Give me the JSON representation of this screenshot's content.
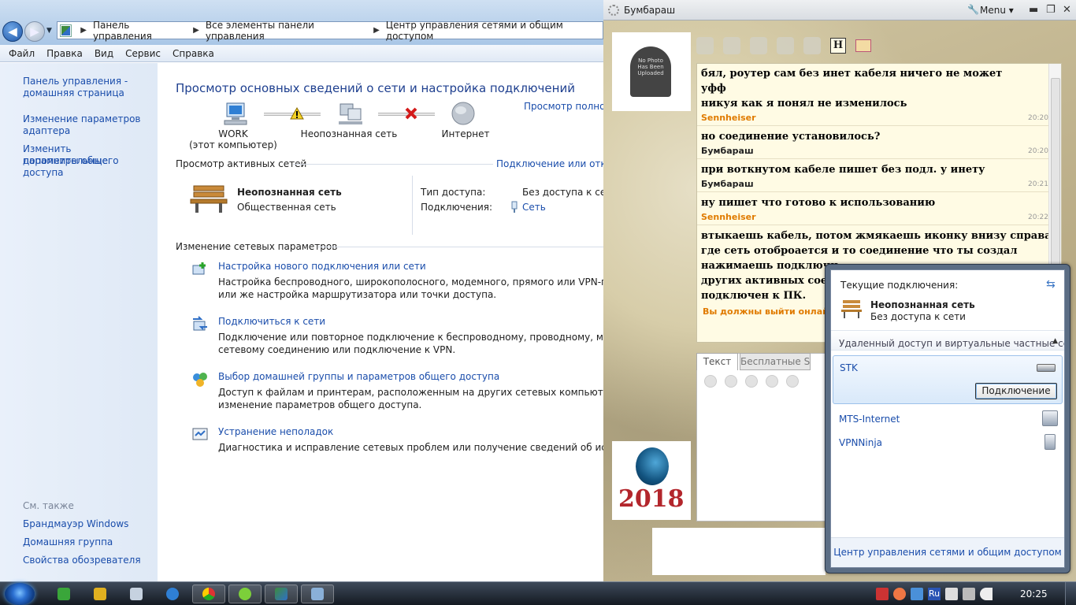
{
  "explorer": {
    "breadcrumb": [
      "Панель управления",
      "Все элементы панели управления",
      "Центр управления сетями и общим доступом"
    ],
    "menu": [
      "Файл",
      "Правка",
      "Вид",
      "Сервис",
      "Справка"
    ],
    "sidebar": {
      "links": [
        "Панель управления -",
        "домашняя страница",
        "Изменение параметров",
        "адаптера",
        "Изменить дополнительные",
        "параметры общего доступа"
      ],
      "see_also_title": "См. также",
      "see_also": [
        "Брандмауэр Windows",
        "Домашняя группа",
        "Свойства обозревателя"
      ]
    },
    "main": {
      "title": "Просмотр основных сведений о сети и настройка подключений",
      "full_map": "Просмотр полной",
      "map": {
        "computer_name": "WORK",
        "computer_sub": "(этот компьютер)",
        "network": "Неопознанная сеть",
        "internet": "Интернет"
      },
      "active_header": "Просмотр активных сетей",
      "connect_disconnect": "Подключение или откл",
      "active": {
        "name": "Неопознанная сеть",
        "type": "Общественная сеть",
        "access_label": "Тип доступа:",
        "access_value": "Без доступа к сети",
        "conn_label": "Подключения:",
        "conn_value": "Сеть"
      },
      "change_header": "Изменение сетевых параметров",
      "tasks": [
        {
          "title": "Настройка нового подключения или сети",
          "line1": "Настройка беспроводного, широкополосного, модемного, прямого или VPN-подклю",
          "line2": "или же настройка маршрутизатора или точки доступа."
        },
        {
          "title": "Подключиться к сети",
          "line1": "Подключение или повторное подключение к беспроводному, проводному, модемному",
          "line2": "сетевому соединению или подключение к VPN."
        },
        {
          "title": "Выбор домашней группы и параметров общего доступа",
          "line1": "Доступ к файлам и принтерам, расположенным на других сетевых компьютерах, или",
          "line2": "изменение параметров общего доступа."
        },
        {
          "title": "Устранение неполадок",
          "line1": "Диагностика и исправление сетевых проблем или получение сведений об исправлени",
          "line2": ""
        }
      ]
    }
  },
  "chat": {
    "title": "Бумбараш",
    "menu_label": "Menu ▾",
    "avatar_text": "No Photo Has Been Uploaded",
    "logo_text": "2018",
    "h_label": "H",
    "messages": [
      {
        "text": "бял, роутер сам без инет кабеля ничего не может"
      },
      {
        "text": "уфф"
      },
      {
        "text": "никуя как я понял не изменилось",
        "nick": "Sennheiser",
        "time": "20:20"
      },
      {
        "text": "но соединение установилось?",
        "nick": "Бумбараш",
        "time": "20:20"
      },
      {
        "text": "при воткнутом кабеле пишет без подл. у инету",
        "nick": "Бумбараш",
        "time": "20:21"
      },
      {
        "text": "ну пишет что готово к использованию",
        "nick": "Sennheiser",
        "time": "20:22"
      },
      {
        "text": "втыкаешь кабель, потом жмякаешь иконку внизу справа"
      },
      {
        "text": "где сеть отоброается и то соединение что ты создал"
      },
      {
        "text": "нажимаешь подключи"
      },
      {
        "text": "других активных соед"
      },
      {
        "text": "подключен к ПК."
      }
    ],
    "warning": "Вы должны выйти онлайн",
    "tab_text": "Текст",
    "tab_sms": "Бесплатные SMS"
  },
  "flyout": {
    "current": "Текущие подключения:",
    "net_name": "Неопознанная сеть",
    "net_status": "Без доступа к сети",
    "vpn_header": "Удаленный доступ и виртуальные частные се...",
    "connections": [
      "STK",
      "MTS-Internet",
      "VPNNinja"
    ],
    "connect_button": "Подключение",
    "footer": "Центр управления сетями и общим доступом"
  },
  "taskbar": {
    "lang": "Ru",
    "clock": "20:25"
  }
}
